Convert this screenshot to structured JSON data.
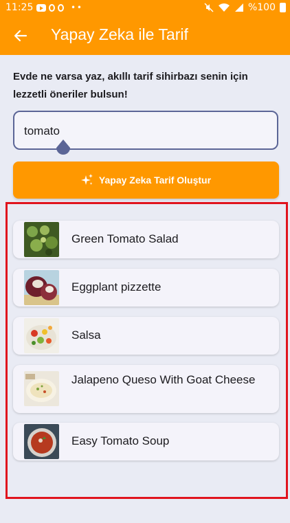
{
  "status_bar": {
    "time": "11:25",
    "battery": "%100"
  },
  "app_bar": {
    "title": "Yapay Zeka ile Tarif",
    "back_icon": "arrow-left-icon"
  },
  "intro_text": "Evde ne varsa yaz, akıllı tarif sihirbazı senin için lezzetli öneriler bulsun!",
  "ingredient_input": {
    "value": "tomato"
  },
  "generate_button": {
    "label": "Yapay Zeka Tarif Oluştur",
    "icon": "sparkles-icon"
  },
  "recipes": [
    {
      "name": "Green Tomato Salad"
    },
    {
      "name": "Eggplant pizzette"
    },
    {
      "name": "Salsa"
    },
    {
      "name": "Jalapeno Queso With Goat Cheese"
    },
    {
      "name": "Easy Tomato Soup"
    }
  ],
  "colors": {
    "primary": "#ff9800",
    "background": "#e9ebf4",
    "card": "#f4f3fa",
    "input_border": "#5b6596",
    "highlight_border": "#e0131d"
  }
}
